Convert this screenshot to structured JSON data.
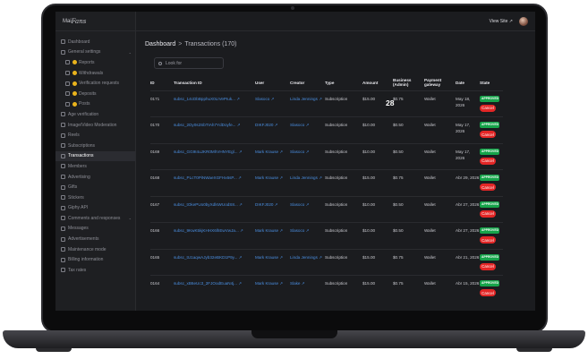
{
  "logo": {
    "prefix": "Mai",
    "script": "Fans"
  },
  "sidebar": {
    "items": [
      {
        "label": "Dashboard",
        "kind": "item"
      },
      {
        "label": "General settings",
        "kind": "group"
      },
      {
        "label": "Reports",
        "kind": "sub"
      },
      {
        "label": "Withdrawals",
        "kind": "sub"
      },
      {
        "label": "Verification requests",
        "kind": "sub"
      },
      {
        "label": "Deposits",
        "kind": "sub"
      },
      {
        "label": "Posts",
        "kind": "sub"
      },
      {
        "label": "Age verification",
        "kind": "item"
      },
      {
        "label": "Image/Video Moderation",
        "kind": "item"
      },
      {
        "label": "Reels",
        "kind": "item"
      },
      {
        "label": "Subscriptions",
        "kind": "item"
      },
      {
        "label": "Transactions",
        "kind": "active"
      },
      {
        "label": "Members",
        "kind": "item"
      },
      {
        "label": "Advertising",
        "kind": "item"
      },
      {
        "label": "Gifts",
        "kind": "item"
      },
      {
        "label": "Stickers",
        "kind": "item"
      },
      {
        "label": "Giphy API",
        "kind": "item"
      },
      {
        "label": "Comments and responses",
        "kind": "group"
      },
      {
        "label": "Messages",
        "kind": "item"
      },
      {
        "label": "Advertisements",
        "kind": "item"
      },
      {
        "label": "Maintenance mode",
        "kind": "item"
      },
      {
        "label": "Billing information",
        "kind": "item"
      },
      {
        "label": "Tax rates",
        "kind": "item"
      }
    ]
  },
  "topbar": {
    "view_site": "View Site ↗"
  },
  "breadcrumb": {
    "root": "Dashboard",
    "sep": ">",
    "current": "Transactions (170)"
  },
  "search": {
    "placeholder": "Look for"
  },
  "overlay_number": "28",
  "table": {
    "headers": [
      "ID",
      "Transaction ID",
      "User",
      "Creator",
      "Type",
      "Amount",
      "Business (Admin)",
      "Payment gateway",
      "Date",
      "State"
    ],
    "rows": [
      {
        "id": "0171",
        "txn": "subsc_14cDbBpphuX0LIVePIuk...",
        "user": "Slasoco",
        "creator": "Linda Jennings",
        "type": "Subscription",
        "amount": "$15.00",
        "business": "$0.75",
        "gateway": "Wallet",
        "date": "May 18, 2026",
        "status": "APPROVED",
        "action": "Cancel"
      },
      {
        "id": "0170",
        "txn": "subsc_2Dy0s2SbTIAh7YdDoyfe...",
        "user": "DIKFJ020",
        "creator": "Slasoco",
        "type": "Subscription",
        "amount": "$10.00",
        "business": "$0.50",
        "gateway": "Wallet",
        "date": "May 17, 2026",
        "status": "APPROVED",
        "action": "Cancel"
      },
      {
        "id": "0169",
        "txn": "subsc_GG9I4uJKR0MhVHNYEgl...",
        "user": "Mark Krause",
        "creator": "Slasoco",
        "type": "Subscription",
        "amount": "$10.00",
        "business": "$0.50",
        "gateway": "Wallet",
        "date": "May 17, 2026",
        "status": "APPROVED",
        "action": "Cancel"
      },
      {
        "id": "0168",
        "txn": "subsc_PLcT0PiNWaeXGFHx6sP...",
        "user": "Mark Krause",
        "creator": "Linda Jennings",
        "type": "Subscription",
        "amount": "$15.00",
        "business": "$0.75",
        "gateway": "Wallet",
        "date": "Abr 29, 2026",
        "status": "APPROVED",
        "action": "Cancel"
      },
      {
        "id": "0167",
        "txn": "subsc_tOkePUo0byXdlsWUodS8...",
        "user": "DIKFJ020",
        "creator": "Slasoco",
        "type": "Subscription",
        "amount": "$10.00",
        "business": "$0.50",
        "gateway": "Wallet",
        "date": "Abr 27, 2026",
        "status": "APPROVED",
        "action": "Cancel"
      },
      {
        "id": "0166",
        "txn": "subsc_9KwK5kjKHHX6lhEwVwJa...",
        "user": "Mark Krause",
        "creator": "Slasoco",
        "type": "Subscription",
        "amount": "$10.00",
        "business": "$0.50",
        "gateway": "Wallet",
        "date": "Abr 27, 2026",
        "status": "APPROVED",
        "action": "Cancel"
      },
      {
        "id": "0165",
        "txn": "subsc_tU1aqwAJyb32eBKD1P9y...",
        "user": "Mark Krause",
        "creator": "Linda Jennings",
        "type": "Subscription",
        "amount": "$15.00",
        "business": "$0.75",
        "gateway": "Wallet",
        "date": "Abr 21, 2026",
        "status": "APPROVED",
        "action": "Cancel"
      },
      {
        "id": "0164",
        "txn": "subsc_xB6eUc3_2FJOodEuaN4j...",
        "user": "Mark Krause",
        "creator": "Slake",
        "type": "Subscription",
        "amount": "$15.00",
        "business": "$0.75",
        "gateway": "Wallet",
        "date": "Abr 15, 2026",
        "status": "APPROVED",
        "action": "Cancel"
      }
    ]
  }
}
